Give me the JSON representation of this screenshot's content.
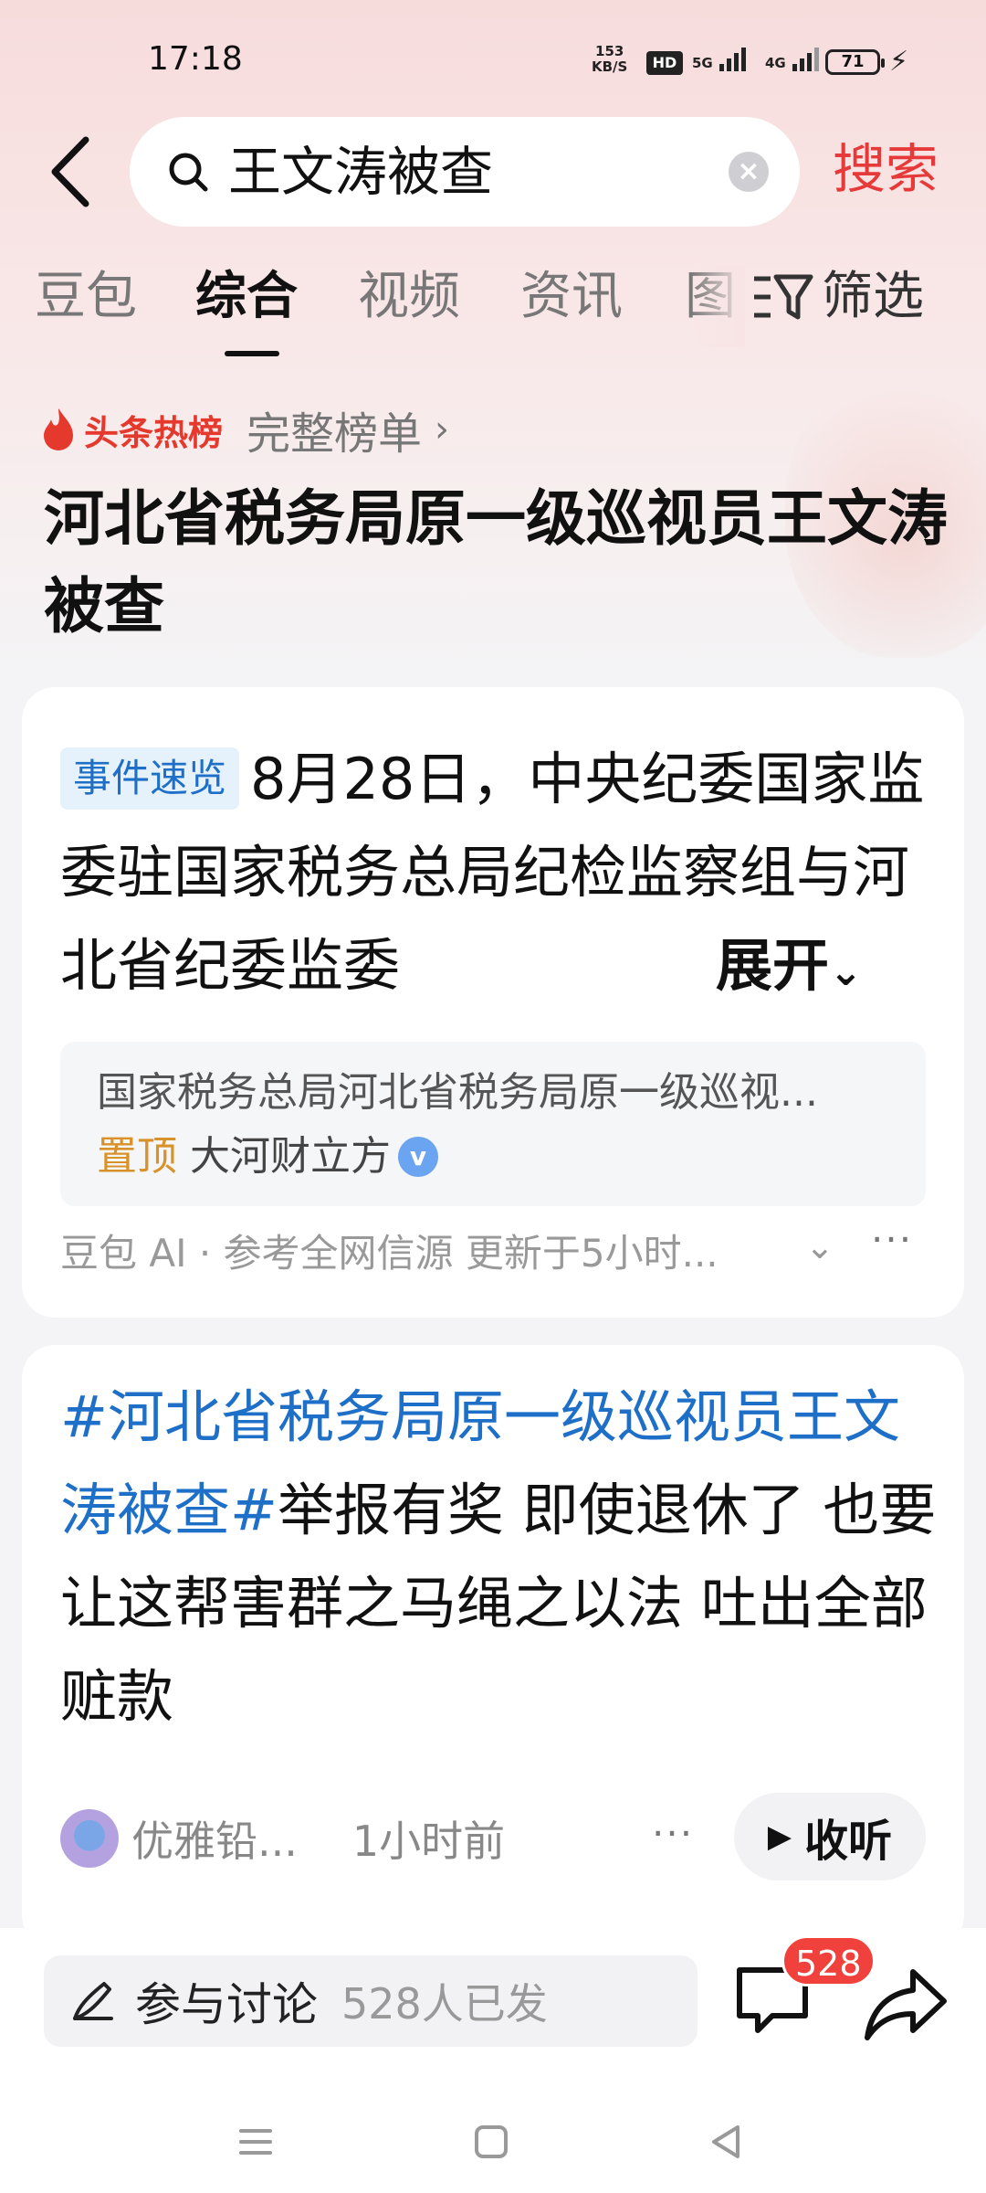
{
  "status_bar": {
    "time": "17:18",
    "net_speed_value": "153",
    "net_speed_unit": "KB/S",
    "hd": "HD",
    "signal_1": "5G",
    "signal_2": "4G",
    "battery": "71"
  },
  "search": {
    "query": "王文涛被查",
    "button_label": "搜索"
  },
  "tabs": [
    {
      "label": "豆包",
      "active": false
    },
    {
      "label": "综合",
      "active": true
    },
    {
      "label": "视频",
      "active": false
    },
    {
      "label": "资讯",
      "active": false
    },
    {
      "label": "图",
      "active": false
    }
  ],
  "filter_label": "筛选",
  "hot_list": {
    "label": "头条热榜",
    "link": "完整榜单"
  },
  "headline": "河北省税务局原一级巡视员王文涛被查",
  "event_card": {
    "badge": "事件速览",
    "summary": "8月28日，中央纪委国家监委驻国家税务总局纪检监察组与河北省纪委监委",
    "expand_label": "展开",
    "source_title": "国家税务总局河北省税务局原一级巡视...",
    "pin_tag": "置顶",
    "source_author": "大河财立方",
    "ai_note": "豆包 AI · 参考全网信源 更新于5小时..."
  },
  "post_card": {
    "hashtag": "#河北省税务局原一级巡视员王文涛被查#",
    "text": "举报有奖 即使退休了 也要让这帮害群之马绳之以法 吐出全部赃款",
    "author": "优雅铅...",
    "time": "1小时前",
    "listen_label": "收听"
  },
  "bottom_bar": {
    "discuss_label": "参与讨论",
    "discuss_count": "528人已发",
    "comment_badge": "528"
  },
  "colors": {
    "accent_red": "#e63a3a",
    "hashtag_blue": "#1e6fc7",
    "pin_orange": "#d9912a"
  }
}
